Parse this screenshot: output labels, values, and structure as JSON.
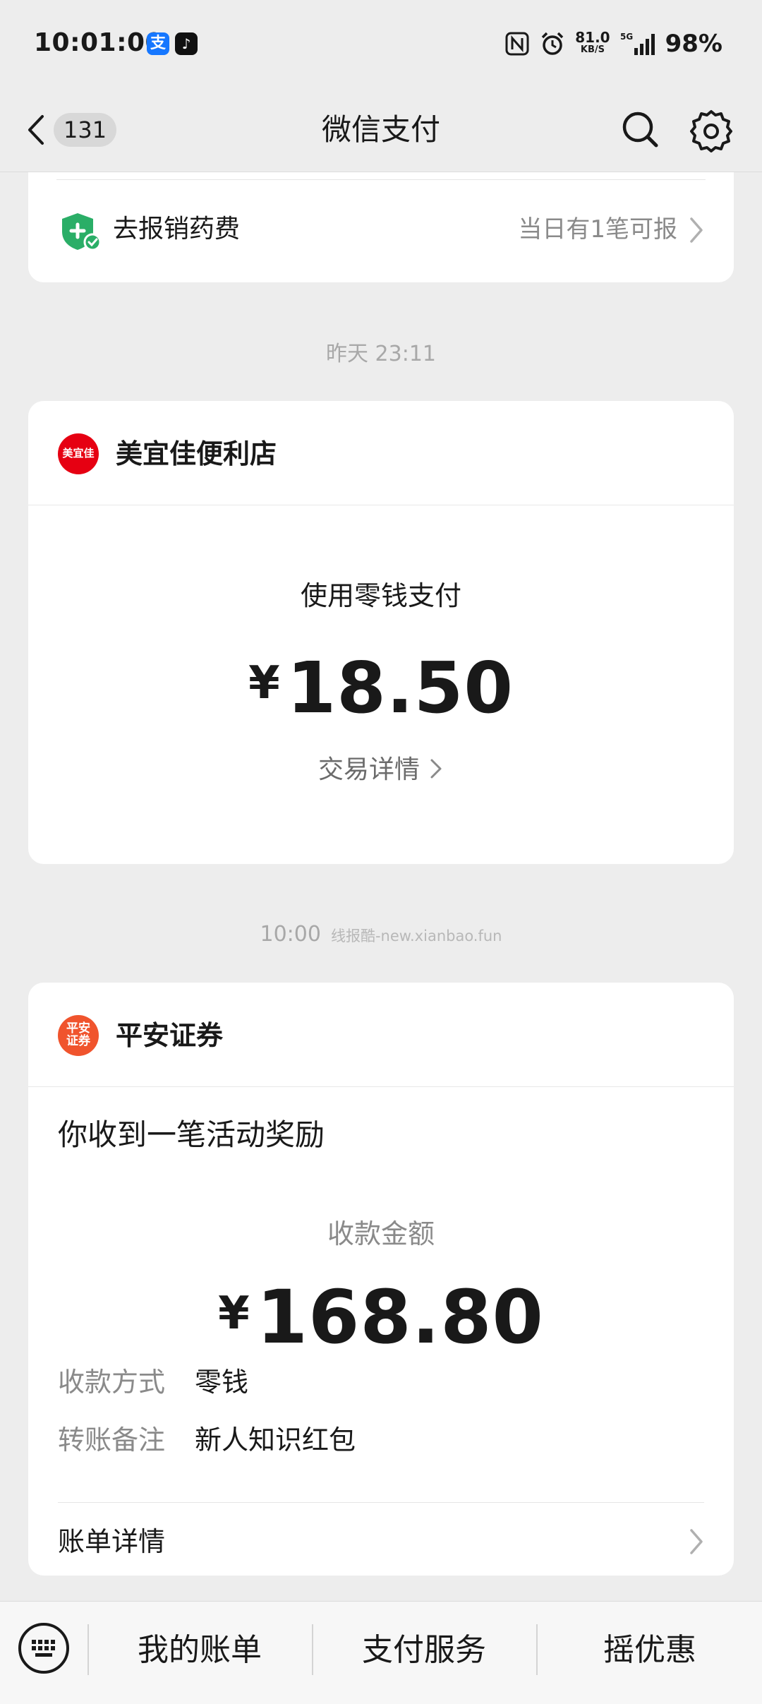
{
  "status_bar": {
    "time": "10:01:00",
    "alipay_glyph": "支",
    "tiktok_glyph": "♪",
    "net_speed": "81.0",
    "net_speed_unit": "KB/S",
    "signal_label": "5G",
    "battery": "98%"
  },
  "nav": {
    "unread_count": "131",
    "title": "微信支付"
  },
  "reimburse": {
    "label": "去报销药费",
    "hint": "当日有1笔可报"
  },
  "time_labels": {
    "first": "昨天 23:11",
    "second": "10:00",
    "watermark": "线报酷-new.xianbao.fun"
  },
  "meiyijia": {
    "logo_text": "美宜佳",
    "name": "美宜佳便利店",
    "pay_method": "使用零钱支付",
    "currency": "¥",
    "amount": "18.50",
    "detail_link": "交易详情"
  },
  "pingan": {
    "logo_line1": "平安",
    "logo_line2": "证券",
    "name": "平安证券",
    "reward_title": "你收到一笔活动奖励",
    "amount_label": "收款金额",
    "currency": "¥",
    "amount": "168.80",
    "method_key": "收款方式",
    "method_value": "零钱",
    "remark_key": "转账备注",
    "remark_value": "新人知识红包",
    "bill_detail": "账单详情"
  },
  "bottom_bar": {
    "tabs": [
      "我的账单",
      "支付服务",
      "摇优惠"
    ]
  },
  "colors": {
    "background": "#ededed",
    "card": "#ffffff",
    "meiyijia_red": "#e60012",
    "pingan_orange": "#f0542d",
    "shield_green": "#2aae67"
  }
}
